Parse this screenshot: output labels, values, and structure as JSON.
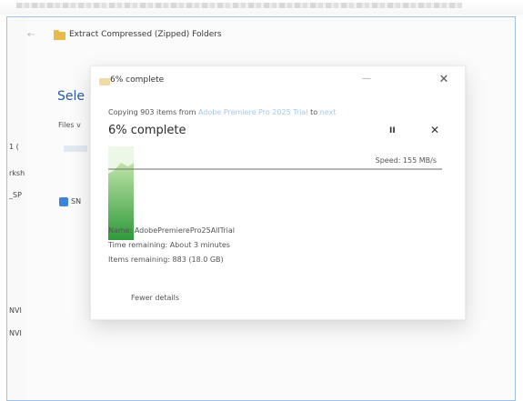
{
  "background": {
    "window_title": "Extract Compressed (Zipped) Folders",
    "heading": "Sele",
    "files_label": "Files v",
    "left_labels": [
      "1 (",
      "rksh",
      "_SP",
      "NVI",
      "NVI"
    ],
    "checkbox_label": "SN"
  },
  "dialog": {
    "title": "6% complete",
    "copy_prefix": "Copying 903 items from ",
    "copy_source": "Adobe Premiere Pro 2025 Trial",
    "copy_mid": " to ",
    "copy_dest": "next",
    "percent_text": "6% complete",
    "progress_fraction": 0.06,
    "pause_label": "II",
    "cancel_label": "✕",
    "minimize_label": "—",
    "close_label": "✕",
    "speed": "Speed: 155 MB/s",
    "name": "Name: AdobePremierePro25AllTrial",
    "time_remaining": "Time remaining: About 3 minutes",
    "items_remaining": "Items remaining: 883 (18.0 GB)",
    "fewer_details": "Fewer details",
    "accent_color": "#3aa83a"
  }
}
